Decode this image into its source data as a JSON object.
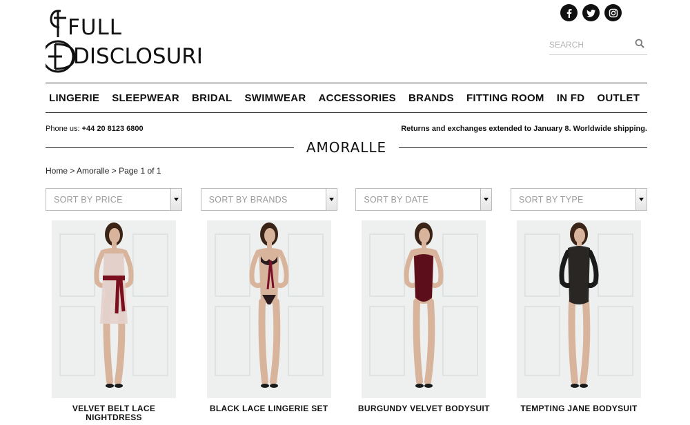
{
  "brand": {
    "logo_line1": "FULL",
    "logo_line2": "DISCLOSURE"
  },
  "social": [
    {
      "icon": "facebook-icon"
    },
    {
      "icon": "twitter-icon"
    },
    {
      "icon": "instagram-icon"
    }
  ],
  "search": {
    "placeholder": "SEARCH",
    "icon": "search-icon"
  },
  "nav": {
    "items": [
      "LINGERIE",
      "SLEEPWEAR",
      "BRIDAL",
      "SWIMWEAR",
      "ACCESSORIES",
      "BRANDS",
      "FITTING ROOM",
      "IN FD",
      "OUTLET"
    ]
  },
  "info": {
    "phone_label": "Phone us:",
    "phone_number": "+44 20 8123 6800",
    "shipping": "Returns and exchanges extended to January 8. Worldwide shipping."
  },
  "page": {
    "title": "AMORALLE"
  },
  "breadcrumb": {
    "home": "Home",
    "sep1": " > ",
    "current": "Amoralle",
    "sep2": " > ",
    "page": "Page 1 of 1"
  },
  "sorts": [
    "SORT BY PRICE",
    "SORT BY BRANDS",
    "SORT BY DATE",
    "SORT BY TYPE"
  ],
  "products": [
    {
      "name": "VELVET BELT LACE NIGHTDRESS",
      "garment": "#e5d2cc",
      "accent": "#7a0f1d"
    },
    {
      "name": "BLACK LACE LINGERIE SET",
      "garment": "#2a1c1e",
      "accent": "#7a0f2a"
    },
    {
      "name": "BURGUNDY VELVET BODYSUIT",
      "garment": "#5c0f1a",
      "accent": "#5c0f1a"
    },
    {
      "name": "TEMPTING JANE BODYSUIT",
      "garment": "#1a1a1a",
      "accent": "#1a1a1a"
    }
  ],
  "colors": {
    "text": "#111111",
    "muted": "#999999",
    "rule": "#333333"
  }
}
